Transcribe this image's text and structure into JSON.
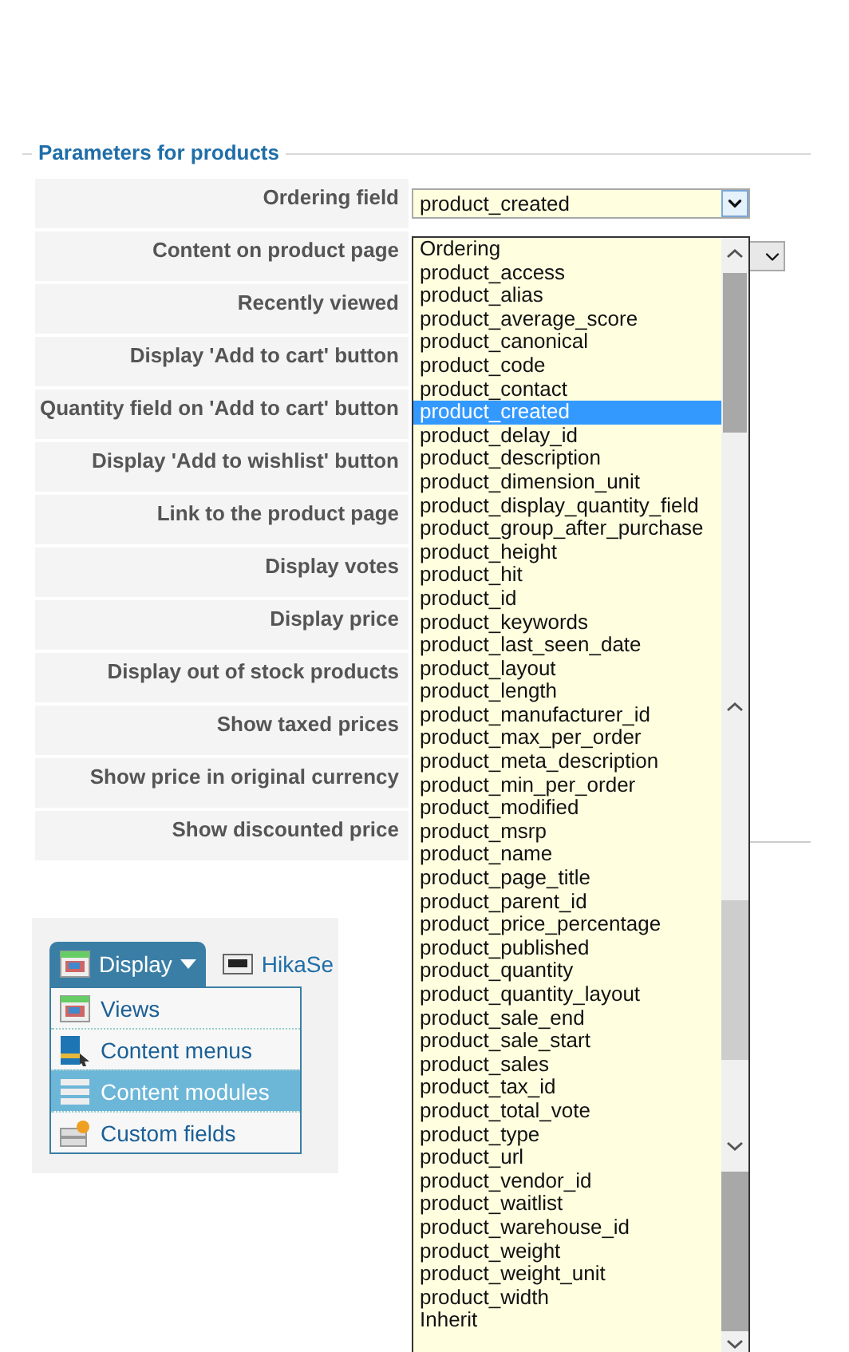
{
  "section": {
    "legend": "Parameters for products"
  },
  "fields": [
    "Ordering field",
    "Content on product page",
    "Recently viewed",
    "Display 'Add to cart' button",
    "Quantity field on 'Add to cart' button",
    "Display 'Add to wishlist' button",
    "Link to the product page",
    "Display votes",
    "Display price",
    "Display out of stock products",
    "Show taxed prices",
    "Show price in original currency",
    "Show discounted price"
  ],
  "ordering_select": {
    "value": "product_created",
    "options": [
      {
        "label": "Ordering",
        "selected": false
      },
      {
        "label": "product_access",
        "selected": false
      },
      {
        "label": "product_alias",
        "selected": false
      },
      {
        "label": "product_average_score",
        "selected": false
      },
      {
        "label": "product_canonical",
        "selected": false
      },
      {
        "label": "product_code",
        "selected": false
      },
      {
        "label": "product_contact",
        "selected": false
      },
      {
        "label": "product_created",
        "selected": true
      },
      {
        "label": "product_delay_id",
        "selected": false
      },
      {
        "label": "product_description",
        "selected": false
      },
      {
        "label": "product_dimension_unit",
        "selected": false
      },
      {
        "label": "product_display_quantity_field",
        "selected": false
      },
      {
        "label": "product_group_after_purchase",
        "selected": false
      },
      {
        "label": "product_height",
        "selected": false
      },
      {
        "label": "product_hit",
        "selected": false
      },
      {
        "label": "product_id",
        "selected": false
      },
      {
        "label": "product_keywords",
        "selected": false
      },
      {
        "label": "product_last_seen_date",
        "selected": false
      },
      {
        "label": "product_layout",
        "selected": false
      },
      {
        "label": "product_length",
        "selected": false
      },
      {
        "label": "product_manufacturer_id",
        "selected": false
      },
      {
        "label": "product_max_per_order",
        "selected": false
      },
      {
        "label": "product_meta_description",
        "selected": false
      },
      {
        "label": "product_min_per_order",
        "selected": false
      },
      {
        "label": "product_modified",
        "selected": false
      },
      {
        "label": "product_msrp",
        "selected": false
      },
      {
        "label": "product_name",
        "selected": false
      },
      {
        "label": "product_page_title",
        "selected": false
      },
      {
        "label": "product_parent_id",
        "selected": false
      },
      {
        "label": "product_price_percentage",
        "selected": false
      },
      {
        "label": "product_published",
        "selected": false
      },
      {
        "label": "product_quantity",
        "selected": false
      },
      {
        "label": "product_quantity_layout",
        "selected": false
      },
      {
        "label": "product_sale_end",
        "selected": false
      },
      {
        "label": "product_sale_start",
        "selected": false
      },
      {
        "label": "product_sales",
        "selected": false
      },
      {
        "label": "product_tax_id",
        "selected": false
      },
      {
        "label": "product_total_vote",
        "selected": false
      },
      {
        "label": "product_type",
        "selected": false
      },
      {
        "label": "product_url",
        "selected": false
      },
      {
        "label": "product_vendor_id",
        "selected": false
      },
      {
        "label": "product_waitlist",
        "selected": false
      },
      {
        "label": "product_warehouse_id",
        "selected": false
      },
      {
        "label": "product_weight",
        "selected": false
      },
      {
        "label": "product_weight_unit",
        "selected": false
      },
      {
        "label": "product_width",
        "selected": false
      },
      {
        "label": "Inherit",
        "selected": false
      }
    ]
  },
  "toolbar": {
    "tabs": [
      {
        "label": "Display",
        "kind": "menu",
        "expanded": true
      },
      {
        "label": "HikaSe",
        "kind": "link",
        "expanded": false
      }
    ],
    "menu": [
      {
        "label": "Views",
        "kind": "views",
        "selected": false
      },
      {
        "label": "Content menus",
        "kind": "menus",
        "selected": false
      },
      {
        "label": "Content modules",
        "kind": "modules",
        "selected": true
      },
      {
        "label": "Custom fields",
        "kind": "fields",
        "selected": false
      }
    ]
  }
}
